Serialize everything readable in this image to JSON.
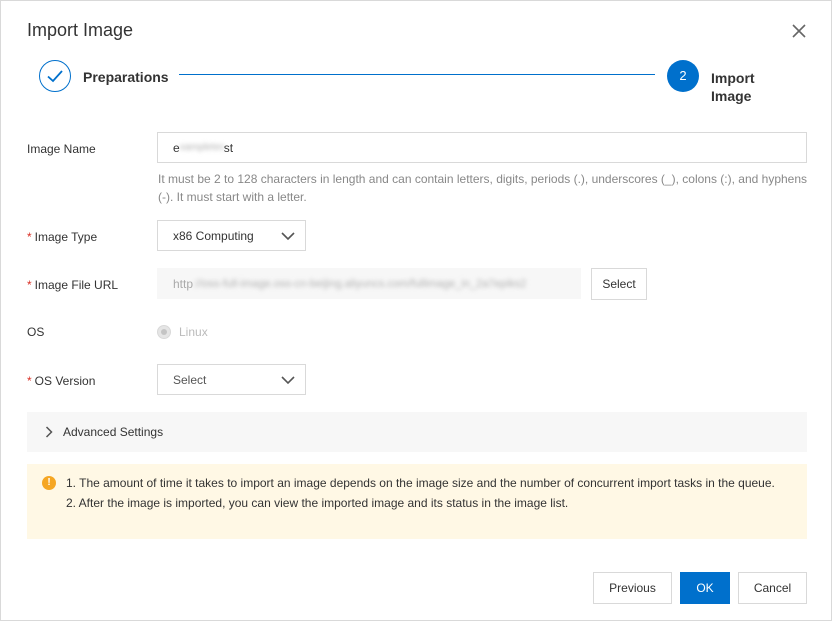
{
  "dialog": {
    "title": "Import Image",
    "close_icon": "close-icon"
  },
  "steps": [
    {
      "label": "Preparations",
      "status": "done",
      "icon": "check-icon"
    },
    {
      "number": "2",
      "label": "Import Image",
      "status": "active"
    }
  ],
  "colors": {
    "primary": "#0070cc",
    "required": "#d93026",
    "warning": "#f5a623",
    "notice_bg": "#fff8e5"
  },
  "form": {
    "image_name": {
      "label": "Image Name",
      "value_prefix": "e",
      "value_obscured": "xampletest",
      "value_suffix": "st",
      "hint": "It must be 2 to 128 characters in length and can contain letters, digits, periods (.), underscores (_), colons (:), and hyphens (-). It must start with a letter."
    },
    "image_type": {
      "required_mark": "*",
      "label": "Image Type",
      "value": "x86 Computing"
    },
    "image_file_url": {
      "required_mark": "*",
      "label": "Image File URL",
      "value_prefix": "http",
      "value_obscured": "://oss-full-image.oss-cn-beijing.aliyuncs.com/fullimage_in_2a7epiks2",
      "select_label": "Select"
    },
    "os": {
      "label": "OS",
      "value": "Linux"
    },
    "os_version": {
      "required_mark": "*",
      "label": "OS Version",
      "placeholder": "Select"
    }
  },
  "advanced": {
    "label": "Advanced Settings",
    "icon": "chevron-right-icon"
  },
  "notice": {
    "icon": "warning-icon",
    "icon_glyph": "!",
    "line1": "1. The amount of time it takes to import an image depends on the image size and the number of concurrent import tasks in the queue.",
    "line2": "2. After the image is imported, you can view the imported image and its status in the image list."
  },
  "footer": {
    "previous": "Previous",
    "ok": "OK",
    "cancel": "Cancel"
  }
}
